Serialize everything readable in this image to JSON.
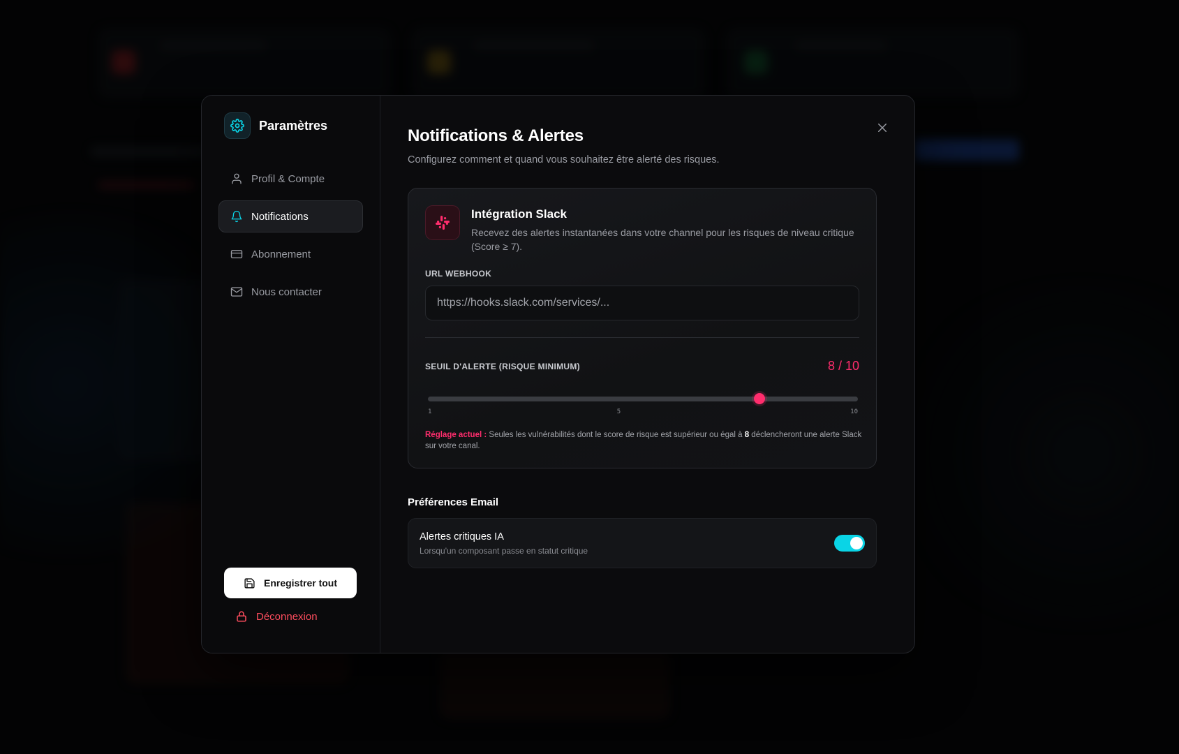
{
  "sidebar": {
    "title": "Paramètres",
    "items": [
      {
        "label": "Profil & Compte",
        "icon": "user-icon"
      },
      {
        "label": "Notifications",
        "icon": "bell-icon",
        "active": true
      },
      {
        "label": "Abonnement",
        "icon": "credit-card-icon"
      },
      {
        "label": "Nous contacter",
        "icon": "mail-icon"
      }
    ],
    "save_label": "Enregistrer tout",
    "logout_label": "Déconnexion"
  },
  "main": {
    "title": "Notifications & Alertes",
    "subtitle": "Configurez comment et quand vous souhaitez être alerté des risques.",
    "slack": {
      "title": "Intégration Slack",
      "description": "Recevez des alertes instantanées dans votre channel pour les risques de niveau critique (Score ≥ 7).",
      "webhook_label": "URL Webhook",
      "webhook_placeholder": "https://hooks.slack.com/services/...",
      "threshold_label": "Seuil d'alerte (Risque minimum)",
      "threshold_display": "8 / 10",
      "threshold": {
        "value": 8,
        "min": 1,
        "max": 10
      },
      "ticks": [
        "1",
        "5",
        "10"
      ],
      "note_highlight": "Réglage actuel :",
      "note_before": " Seules les vulnérabilités dont le score de risque est supérieur ou égal à ",
      "note_value": "8",
      "note_after": " déclencheront une alerte Slack sur votre canal."
    },
    "email": {
      "section_title": "Préférences Email",
      "items": [
        {
          "name": "Alertes critiques IA",
          "description": "Lorsqu'un composant passe en statut critique",
          "enabled": true
        }
      ]
    }
  },
  "colors": {
    "accent_cyan": "#0ad4e6",
    "accent_pink": "#ff2d6d",
    "danger": "#ff4d5e"
  }
}
